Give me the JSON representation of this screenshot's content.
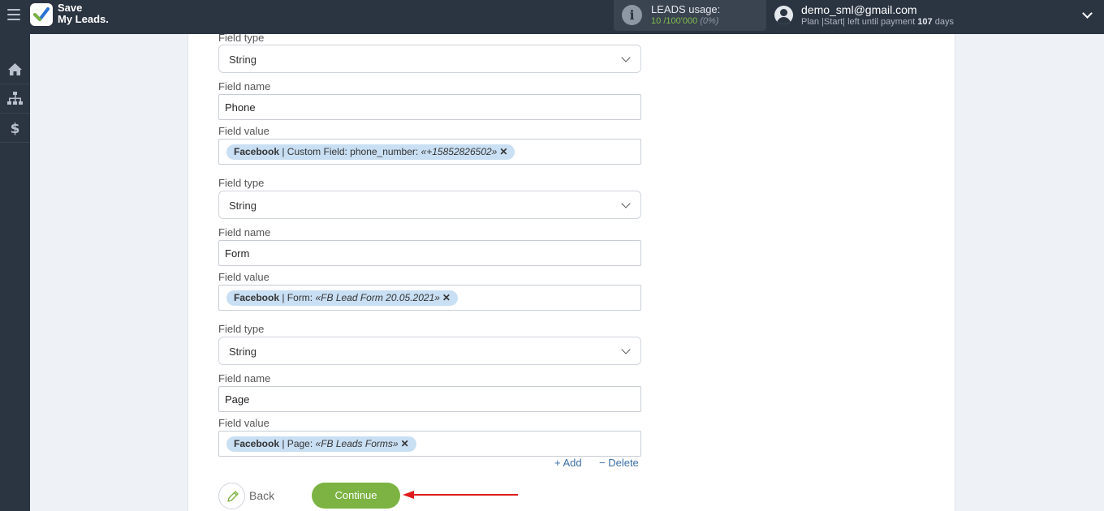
{
  "header": {
    "logo_line1": "Save",
    "logo_line2": "My Leads.",
    "usage_label": "LEADS usage:",
    "usage_used": "10",
    "usage_sep": "/",
    "usage_total": "100'000",
    "usage_pct": "(0%)",
    "email": "demo_sml@gmail.com",
    "plan_text": "Plan |Start| left until payment",
    "plan_days": "107",
    "plan_suffix": "days"
  },
  "sidebar": {
    "items": [
      {
        "icon": "home-icon"
      },
      {
        "icon": "sitemap-icon"
      },
      {
        "icon": "dollar-icon"
      }
    ]
  },
  "labels": {
    "field_type": "Field type",
    "field_name": "Field name",
    "field_value": "Field value"
  },
  "fields": [
    {
      "type": "String",
      "name": "Phone",
      "value_source": "Facebook",
      "value_prefix": "| Custom Field: phone_number:",
      "value_sample": "«+15852826502»"
    },
    {
      "type": "String",
      "name": "Form",
      "value_source": "Facebook",
      "value_prefix": "| Form:",
      "value_sample": "«FB Lead Form 20.05.2021»"
    },
    {
      "type": "String",
      "name": "Page",
      "value_source": "Facebook",
      "value_prefix": "| Page:",
      "value_sample": "«FB Leads Forms»"
    }
  ],
  "actions": {
    "add": "+ Add",
    "delete": "− Delete",
    "back": "Back",
    "continue": "Continue"
  },
  "colors": {
    "topbar": "#2b3441",
    "accent_green": "#7cb342",
    "tag_bg": "#c9dff3",
    "link": "#3b6fa5",
    "arrow": "#e01b1b"
  }
}
